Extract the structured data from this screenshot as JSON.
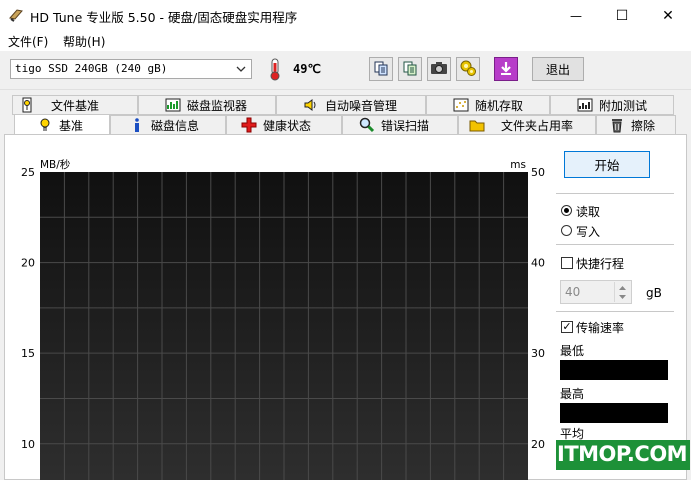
{
  "window": {
    "title": "HD Tune 专业版 5.50 - 硬盘/固态硬盘实用程序",
    "minimize_glyph": "—",
    "maximize_glyph": "☐",
    "close_glyph": "✕"
  },
  "menu": {
    "file": "文件(F)",
    "help": "帮助(H)"
  },
  "toolbar": {
    "drive": "tigo SSD 240GB (240 gB)",
    "temperature": "49℃",
    "exit_label": "退出",
    "buttons": [
      "copy-icon",
      "copy-all-icon",
      "camera-icon",
      "options-icon",
      "save-download-icon"
    ]
  },
  "tabs_row1": [
    {
      "label": "文件基准",
      "icon": "file-benchmark-icon"
    },
    {
      "label": "磁盘监视器",
      "icon": "disk-monitor-icon"
    },
    {
      "label": "自动噪音管理",
      "icon": "speaker-icon"
    },
    {
      "label": "随机存取",
      "icon": "random-access-icon"
    },
    {
      "label": "附加测试",
      "icon": "extra-tests-icon"
    }
  ],
  "tabs_row2": [
    {
      "label": "基准",
      "icon": "benchmark-icon",
      "active": true
    },
    {
      "label": "磁盘信息",
      "icon": "info-icon"
    },
    {
      "label": "健康状态",
      "icon": "health-icon"
    },
    {
      "label": "错误扫描",
      "icon": "magnifier-icon"
    },
    {
      "label": "文件夹占用率",
      "icon": "folder-icon"
    },
    {
      "label": "擦除",
      "icon": "trash-icon"
    }
  ],
  "controls": {
    "start_label": "开始",
    "read_label": "读取",
    "write_label": "写入",
    "read_checked": true,
    "quick_label": "快捷行程",
    "quick_checked": false,
    "quick_value": "40",
    "quick_unit": "gB",
    "transfer_label": "传输速率",
    "transfer_checked": true,
    "min_label": "最低",
    "max_label": "最高",
    "avg_label": "平均"
  },
  "chart_data": {
    "type": "line",
    "left_unit": "MB/秒",
    "right_unit": "ms",
    "left_ticks": [
      "25",
      "20",
      "15",
      "10"
    ],
    "right_ticks": [
      "50",
      "40",
      "30",
      "20"
    ],
    "y_left_visible_range": [
      8,
      25
    ],
    "y_right_visible_range": [
      16,
      50
    ],
    "grid": true,
    "series": []
  },
  "watermark": "ITMOP.COM",
  "colors": {
    "chart_bg_top": "#101010",
    "chart_bg_bottom": "#2e2e2e",
    "grid": "#4a4a4a",
    "start_border": "#0078d7",
    "watermark_bg": "#1d9138"
  }
}
